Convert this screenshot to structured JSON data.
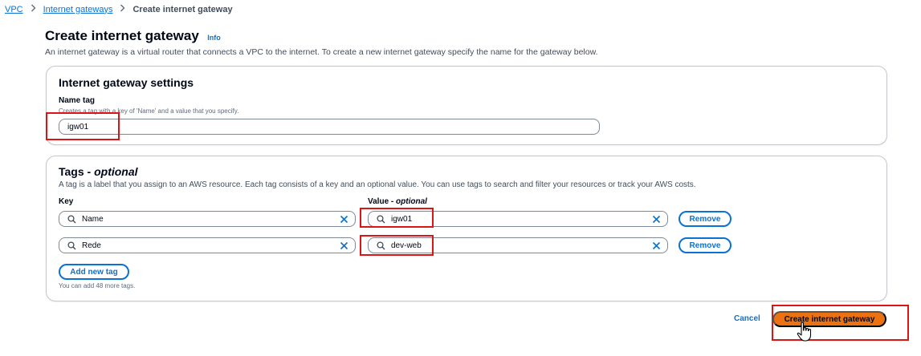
{
  "breadcrumb": {
    "items": [
      "VPC",
      "Internet gateways"
    ],
    "current": "Create internet gateway"
  },
  "header": {
    "title": "Create internet gateway",
    "info": "Info",
    "description": "An internet gateway is a virtual router that connects a VPC to the internet. To create a new internet gateway specify the name for the gateway below."
  },
  "settings": {
    "title": "Internet gateway settings",
    "name_tag_label": "Name tag",
    "name_tag_hint": "Creates a tag with a key of 'Name' and a value that you specify.",
    "name_tag_value": "igw01"
  },
  "tags": {
    "title": "Tags",
    "title_suffix": "optional",
    "description": "A tag is a label that you assign to an AWS resource. Each tag consists of a key and an optional value. You can use tags to search and filter your resources or track your AWS costs.",
    "key_header": "Key",
    "value_header": "Value",
    "value_header_suffix": "optional",
    "rows": [
      {
        "key": "Name",
        "value": "igw01",
        "remove_label": "Remove"
      },
      {
        "key": "Rede",
        "value": "dev-web",
        "remove_label": "Remove"
      }
    ],
    "add_label": "Add new tag",
    "limit_text": "You can add 48 more tags."
  },
  "footer": {
    "cancel_label": "Cancel",
    "submit_label": "Create internet gateway"
  },
  "colors": {
    "accent": "#0972d3",
    "primary_button": "#ec7211",
    "highlight": "#d91515"
  },
  "icons": {
    "breadcrumb_separator": "chevron-right-icon",
    "search": "search-icon",
    "clear": "close-icon",
    "pointer": "hand-pointer-icon"
  }
}
